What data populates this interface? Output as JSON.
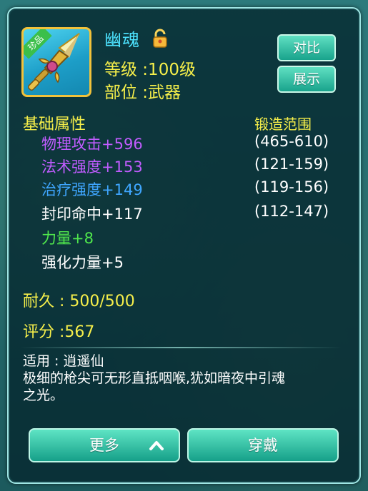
{
  "item": {
    "rarity_tag": "珍品",
    "name": "幽魂",
    "level_line": "等级 :100级",
    "slot_line": "部位 :武器"
  },
  "buttons": {
    "compare": "对比",
    "show": "展示",
    "more": "更多",
    "equip": "穿戴"
  },
  "attributes": {
    "base_title": "基础属性",
    "forge_title": "锻造范围",
    "list": [
      {
        "text": "物理攻击+596",
        "color": "#c15cff",
        "range": "(465-610)"
      },
      {
        "text": "法术强度+153",
        "color": "#c15cff",
        "range": "(121-159)"
      },
      {
        "text": "治疗强度+149",
        "color": "#3fa6ff",
        "range": "(119-156)"
      },
      {
        "text": "封印命中+117",
        "color": "#ffffff",
        "range": "(112-147)"
      }
    ],
    "extra": [
      {
        "text": "力量+8",
        "color": "#50e84c"
      },
      {
        "text": "强化力量+5",
        "color": "#ffffff"
      }
    ]
  },
  "stats": {
    "durability": "耐久 : 500/500",
    "score": "评分 :567"
  },
  "description": {
    "applies": "适用 : 逍遥仙",
    "line1": "极细的枪尖可无形直抵咽喉,犹如暗夜中引魂",
    "line2": "之光。"
  },
  "icons": [
    "unlocked-padlock-icon",
    "spear-weapon-icon",
    "chevron-up-icon"
  ]
}
